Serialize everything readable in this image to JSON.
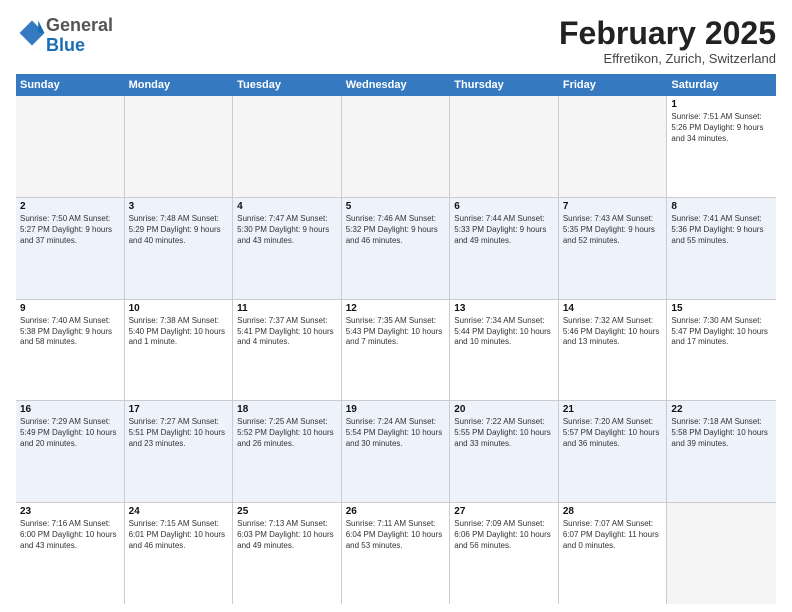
{
  "header": {
    "logo_general": "General",
    "logo_blue": "Blue",
    "month_title": "February 2025",
    "location": "Effretikon, Zurich, Switzerland"
  },
  "weekdays": [
    "Sunday",
    "Monday",
    "Tuesday",
    "Wednesday",
    "Thursday",
    "Friday",
    "Saturday"
  ],
  "weeks": [
    [
      {
        "day": "",
        "info": "",
        "empty": true
      },
      {
        "day": "",
        "info": "",
        "empty": true
      },
      {
        "day": "",
        "info": "",
        "empty": true
      },
      {
        "day": "",
        "info": "",
        "empty": true
      },
      {
        "day": "",
        "info": "",
        "empty": true
      },
      {
        "day": "",
        "info": "",
        "empty": true
      },
      {
        "day": "1",
        "info": "Sunrise: 7:51 AM\nSunset: 5:26 PM\nDaylight: 9 hours and 34 minutes."
      }
    ],
    [
      {
        "day": "2",
        "info": "Sunrise: 7:50 AM\nSunset: 5:27 PM\nDaylight: 9 hours and 37 minutes."
      },
      {
        "day": "3",
        "info": "Sunrise: 7:48 AM\nSunset: 5:29 PM\nDaylight: 9 hours and 40 minutes."
      },
      {
        "day": "4",
        "info": "Sunrise: 7:47 AM\nSunset: 5:30 PM\nDaylight: 9 hours and 43 minutes."
      },
      {
        "day": "5",
        "info": "Sunrise: 7:46 AM\nSunset: 5:32 PM\nDaylight: 9 hours and 46 minutes."
      },
      {
        "day": "6",
        "info": "Sunrise: 7:44 AM\nSunset: 5:33 PM\nDaylight: 9 hours and 49 minutes."
      },
      {
        "day": "7",
        "info": "Sunrise: 7:43 AM\nSunset: 5:35 PM\nDaylight: 9 hours and 52 minutes."
      },
      {
        "day": "8",
        "info": "Sunrise: 7:41 AM\nSunset: 5:36 PM\nDaylight: 9 hours and 55 minutes."
      }
    ],
    [
      {
        "day": "9",
        "info": "Sunrise: 7:40 AM\nSunset: 5:38 PM\nDaylight: 9 hours and 58 minutes."
      },
      {
        "day": "10",
        "info": "Sunrise: 7:38 AM\nSunset: 5:40 PM\nDaylight: 10 hours and 1 minute."
      },
      {
        "day": "11",
        "info": "Sunrise: 7:37 AM\nSunset: 5:41 PM\nDaylight: 10 hours and 4 minutes."
      },
      {
        "day": "12",
        "info": "Sunrise: 7:35 AM\nSunset: 5:43 PM\nDaylight: 10 hours and 7 minutes."
      },
      {
        "day": "13",
        "info": "Sunrise: 7:34 AM\nSunset: 5:44 PM\nDaylight: 10 hours and 10 minutes."
      },
      {
        "day": "14",
        "info": "Sunrise: 7:32 AM\nSunset: 5:46 PM\nDaylight: 10 hours and 13 minutes."
      },
      {
        "day": "15",
        "info": "Sunrise: 7:30 AM\nSunset: 5:47 PM\nDaylight: 10 hours and 17 minutes."
      }
    ],
    [
      {
        "day": "16",
        "info": "Sunrise: 7:29 AM\nSunset: 5:49 PM\nDaylight: 10 hours and 20 minutes."
      },
      {
        "day": "17",
        "info": "Sunrise: 7:27 AM\nSunset: 5:51 PM\nDaylight: 10 hours and 23 minutes."
      },
      {
        "day": "18",
        "info": "Sunrise: 7:25 AM\nSunset: 5:52 PM\nDaylight: 10 hours and 26 minutes."
      },
      {
        "day": "19",
        "info": "Sunrise: 7:24 AM\nSunset: 5:54 PM\nDaylight: 10 hours and 30 minutes."
      },
      {
        "day": "20",
        "info": "Sunrise: 7:22 AM\nSunset: 5:55 PM\nDaylight: 10 hours and 33 minutes."
      },
      {
        "day": "21",
        "info": "Sunrise: 7:20 AM\nSunset: 5:57 PM\nDaylight: 10 hours and 36 minutes."
      },
      {
        "day": "22",
        "info": "Sunrise: 7:18 AM\nSunset: 5:58 PM\nDaylight: 10 hours and 39 minutes."
      }
    ],
    [
      {
        "day": "23",
        "info": "Sunrise: 7:16 AM\nSunset: 6:00 PM\nDaylight: 10 hours and 43 minutes."
      },
      {
        "day": "24",
        "info": "Sunrise: 7:15 AM\nSunset: 6:01 PM\nDaylight: 10 hours and 46 minutes."
      },
      {
        "day": "25",
        "info": "Sunrise: 7:13 AM\nSunset: 6:03 PM\nDaylight: 10 hours and 49 minutes."
      },
      {
        "day": "26",
        "info": "Sunrise: 7:11 AM\nSunset: 6:04 PM\nDaylight: 10 hours and 53 minutes."
      },
      {
        "day": "27",
        "info": "Sunrise: 7:09 AM\nSunset: 6:06 PM\nDaylight: 10 hours and 56 minutes."
      },
      {
        "day": "28",
        "info": "Sunrise: 7:07 AM\nSunset: 6:07 PM\nDaylight: 11 hours and 0 minutes."
      },
      {
        "day": "",
        "info": "",
        "empty": true
      }
    ]
  ]
}
